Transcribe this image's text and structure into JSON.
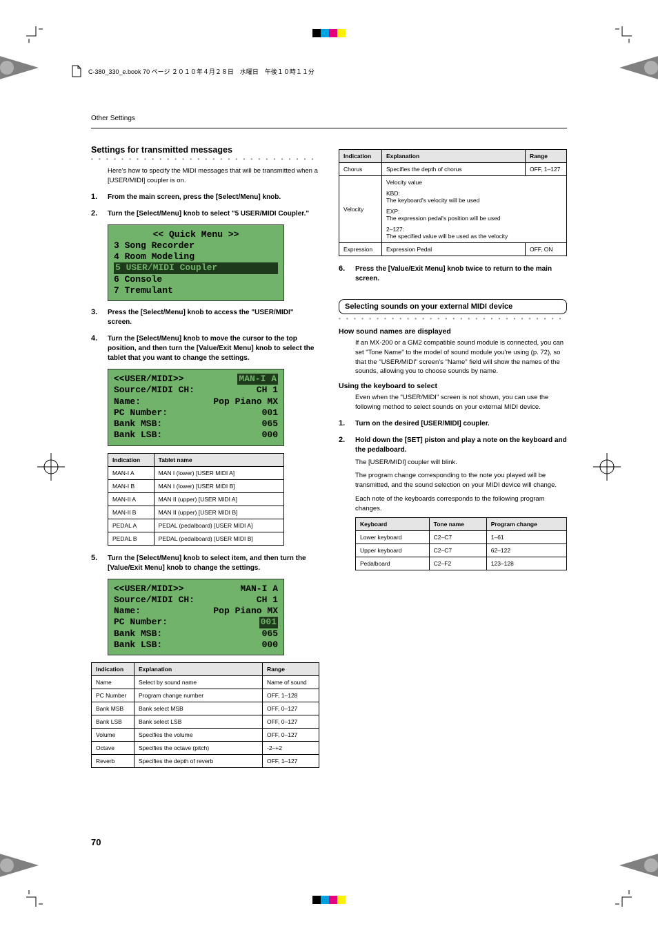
{
  "print_header": "C-380_330_e.book  70 ページ  ２０１０年４月２８日　水曜日　午後１０時１１分",
  "running_head": "Other Settings",
  "page_number": "70",
  "left": {
    "section_title": "Settings for transmitted messages",
    "intro": "Here's how to specify the MIDI messages that will be transmitted when a [USER/MIDI] coupler is on.",
    "steps": {
      "s1": "From the main screen, press the [Select/Menu] knob.",
      "s2": "Turn the [Select/Menu] knob to select \"5 USER/MIDI Coupler.\"",
      "s3": "Press the [Select/Menu] knob to access the \"USER/MIDI\" screen.",
      "s4": "Turn the [Select/Menu] knob to move the cursor to the top position, and then turn the [Value/Exit Menu] knob to select the tablet that you want to change the settings.",
      "s5": "Turn the [Select/Menu] knob to select item, and then turn the [Value/Exit Menu] knob to change the settings."
    },
    "lcd1": {
      "title": "<< Quick Menu >>",
      "l1": "3 Song Recorder",
      "l2": "4 Room Modeling",
      "l3": "5 USER/MIDI Coupler",
      "l4": "6 Console",
      "l5": "7 Tremulant"
    },
    "lcd2": {
      "head_left": "<<USER/MIDI>>",
      "head_right": "MAN-I A",
      "r1l": "Source/MIDI CH:",
      "r1r": "CH 1",
      "r2l": "Name:",
      "r2r": "Pop Piano MX",
      "r3l": "PC Number:",
      "r3r": "001",
      "r4l": "Bank MSB:",
      "r4r": "065",
      "r5l": "Bank LSB:",
      "r5r": "000"
    },
    "lcd3": {
      "head_left": "<<USER/MIDI>>",
      "head_right": "MAN-I A",
      "r1l": "Source/MIDI CH:",
      "r1r": "CH 1",
      "r2l": "Name:",
      "r2r": "Pop Piano MX",
      "r3l": "PC Number:",
      "r3r": "001",
      "r4l": "Bank MSB:",
      "r4r": "065",
      "r5l": "Bank LSB:",
      "r5r": "000"
    },
    "table_tablets": {
      "h1": "Indication",
      "h2": "Tablet name",
      "rows": [
        {
          "c1": "MAN-I A",
          "c2": "MAN I (lower) [USER MIDI A]"
        },
        {
          "c1": "MAN-I B",
          "c2": "MAN I (lower) [USER MIDI B]"
        },
        {
          "c1": "MAN-II A",
          "c2": "MAN II (upper) [USER MIDI A]"
        },
        {
          "c1": "MAN-II B",
          "c2": "MAN II (upper) [USER MIDI B]"
        },
        {
          "c1": "PEDAL A",
          "c2": "PEDAL (pedalboard) [USER MIDI A]"
        },
        {
          "c1": "PEDAL B",
          "c2": "PEDAL (pedalboard) [USER MIDI B]"
        }
      ]
    },
    "table_params1": {
      "h1": "Indication",
      "h2": "Explanation",
      "h3": "Range",
      "rows": [
        {
          "c1": "Name",
          "c2": "Select by sound name",
          "c3": "Name of sound"
        },
        {
          "c1": "PC Number",
          "c2": "Program change number",
          "c3": "OFF, 1–128"
        },
        {
          "c1": "Bank MSB",
          "c2": "Bank select MSB",
          "c3": "OFF, 0–127"
        },
        {
          "c1": "Bank LSB",
          "c2": "Bank select LSB",
          "c3": "OFF, 0–127"
        },
        {
          "c1": "Volume",
          "c2": "Specifies the volume",
          "c3": "OFF, 0–127"
        },
        {
          "c1": "Octave",
          "c2": "Specifies the octave (pitch)",
          "c3": "-2–+2"
        },
        {
          "c1": "Reverb",
          "c2": "Specifies the depth of reverb",
          "c3": "OFF, 1–127"
        }
      ]
    }
  },
  "right": {
    "table_params2": {
      "h1": "Indication",
      "h2": "Explanation",
      "h3": "Range",
      "rows": [
        {
          "c1": "Chorus",
          "c2": "Specifies the depth of chorus",
          "c3": "OFF, 1–127"
        }
      ],
      "velocity": {
        "c1": "Velocity",
        "l0": "Velocity value",
        "l1a": "KBD:",
        "l1b": "The keyboard's velocity will be used",
        "l2a": "EXP:",
        "l2b": "The expression pedal's position will be used",
        "l3a": "2–127:",
        "l3b": "The specified value will be used as the velocity"
      },
      "expression": {
        "c1": "Expression",
        "c2": "Expression Pedal",
        "c3": "OFF, ON"
      }
    },
    "step6": "Press the [Value/Exit Menu] knob twice to return to the main screen.",
    "boxed": "Selecting sounds on your external MIDI device",
    "howsound_h": "How sound names are displayed",
    "howsound_p": "If an MX-200 or a GM2 compatible sound module is connected, you can set \"Tone Name\" to the model of sound module you're using (p. 72), so that the \"USER/MIDI\" screen's \"Name\" field will show the names of the sounds, allowing you to choose sounds by name.",
    "usekb_h": "Using the keyboard to select",
    "usekb_p": "Even when the \"USER/MIDI\" screen is not shown, you can use the following method to select sounds on your external MIDI device.",
    "r_s1": "Turn on the desired [USER/MIDI] coupler.",
    "r_s2": "Hold down the [SET] piston and play a note on the keyboard and the pedalboard.",
    "r_s2_sub1": "The [USER/MIDI] coupler will blink.",
    "r_s2_sub2": "The program change corresponding to the note you played will be transmitted, and the sound selection on your MIDI device will change.",
    "r_s2_sub3": "Each note of the keyboards corresponds to the following program changes.",
    "table_pc": {
      "h1": "Keyboard",
      "h2": "Tone name",
      "h3": "Program change",
      "rows": [
        {
          "c1": "Lower keyboard",
          "c2": "C2–C7",
          "c3": "1–61"
        },
        {
          "c1": "Upper keyboard",
          "c2": "C2–C7",
          "c3": "62–122"
        },
        {
          "c1": "Pedalboard",
          "c2": "C2–F2",
          "c3": "123–128"
        }
      ]
    }
  }
}
